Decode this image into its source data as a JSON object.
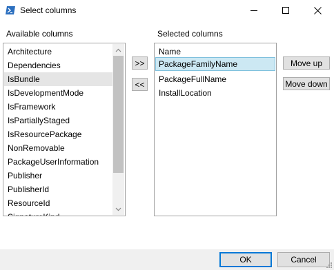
{
  "window": {
    "title": "Select columns",
    "icon": "powershell-icon"
  },
  "titlebar_controls": {
    "minimize_icon": "minimize-icon",
    "maximize_icon": "maximize-icon",
    "close_icon": "close-icon"
  },
  "available": {
    "label": "Available columns",
    "items": [
      "Architecture",
      "Dependencies",
      "IsBundle",
      "IsDevelopmentMode",
      "IsFramework",
      "IsPartiallyStaged",
      "IsResourcePackage",
      "NonRemovable",
      "PackageUserInformation",
      "Publisher",
      "PublisherId",
      "ResourceId",
      "SignatureKind"
    ],
    "selected": "IsBundle"
  },
  "transfer": {
    "add_label": ">>",
    "remove_label": "<<"
  },
  "selected": {
    "label": "Selected columns",
    "items": [
      "Name",
      "PackageFamilyName",
      "PackageFullName",
      "InstallLocation"
    ],
    "selected": "PackageFamilyName"
  },
  "order": {
    "move_up_label": "Move up",
    "move_down_label": "Move down"
  },
  "footer": {
    "ok_label": "OK",
    "cancel_label": "Cancel"
  },
  "colors": {
    "selection_blue": "#cce8f3",
    "selection_gray": "#e5e5e5",
    "accent": "#0078d7",
    "button_face": "#e1e1e1"
  }
}
